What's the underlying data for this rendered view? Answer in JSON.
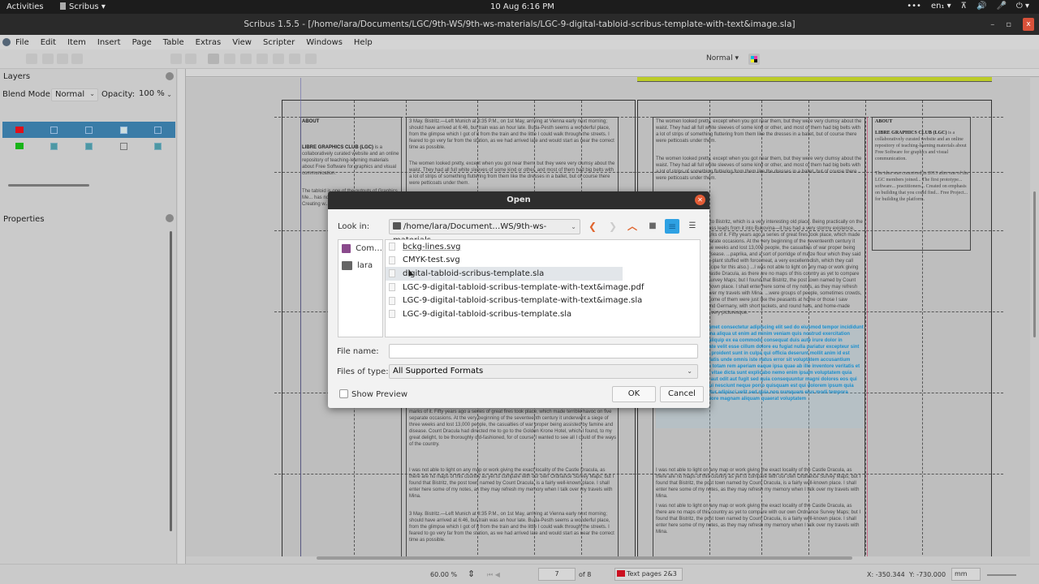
{
  "system_bar": {
    "activities": "Activities",
    "app_name": "Scribus",
    "app_menu_arrow": "▾",
    "clock": "10 Aug  6:16 PM",
    "tray": {
      "more": "•••",
      "language": "en₁ ▾",
      "network_icon": "⊼",
      "volume_icon": "🔊",
      "mic_icon": "🎤",
      "power_icon": "⏻ ▾"
    }
  },
  "window": {
    "title": "Scribus 1.5.5 - [/home/lara/Documents/LGC/9th-WS/9th-ws-materials/LGC-9-digital-tabloid-scribus-template-with-text&image.sla]",
    "minimize": "–",
    "maximize": "▫",
    "close": "x"
  },
  "menubar": [
    "File",
    "Edit",
    "Item",
    "Insert",
    "Page",
    "Table",
    "Extras",
    "View",
    "Scripter",
    "Windows",
    "Help"
  ],
  "toolbar": {
    "image_mode": "Normal",
    "image_mode_arrow": "▾"
  },
  "layers_panel": {
    "title": "Layers",
    "blend_mode_label": "Blend Mode:",
    "blend_mode_value": "Normal",
    "opacity_label": "Opacity:",
    "opacity_value": "100 %",
    "layers": [
      {
        "color": "#e0101a",
        "selected": true,
        "visible": false,
        "printable": false,
        "locked": true,
        "flow": false
      },
      {
        "color": "#18b418",
        "selected": false,
        "visible": true,
        "printable": true,
        "locked": false,
        "flow": true
      }
    ]
  },
  "properties_panel": {
    "title": "Properties"
  },
  "progress": {
    "fraction": 1.0,
    "color": "#bccc28"
  },
  "document": {
    "page_left": {
      "about_heading": "ABOUT",
      "about_body_bold": "LIBRE GRAPHICS CLUB (LGC)",
      "about_body": " is a collaboratively curated website and an online repository of teaching-learning materials about Free Software for graphics and visual communication.",
      "col2_text1": "3 May. Bistritz.—Left Munich at 8:35 P.M., on 1st May, arriving at Vienna early next morning; should have arrived at 6:46, but train was an hour late. Buda-Pesth seems a wonderful place, from the glimpse which I got of it from the train and the little I could walk through the streets. I feared to go very far from the station, as we had arrived late and would start as near the correct time as possible.",
      "col2_text2": "The women looked pretty, except when you got near them, but they were very clumsy about the waist. They had all full white sleeves of some kind or other, and most of them had big belts with a lot of strips of something fluttering from them like the dresses in a ballet, but of course there were petticoats under them.",
      "col1_text3": "The tabloid is one of the outputs of Graphics Me... has not a... software. T... designers... Creating w... this source...",
      "col2_text3": "marks of it. Fifty years ago a series of great fires took place, which made terrible havoc on five separate occasions. At the very beginning of the seventeenth century it underwent a siege of three weeks and lost 13,000 people, the casualties of war proper being assisted by famine and disease. Count Dracula had directed me to go to the Golden Krone Hotel, which I found, to my great delight, to be thoroughly old-fashioned, for of course I wanted to see all I could of the ways of the country.",
      "col2_text4": "I was not able to light on any map or work giving the exact locality of the Castle Dracula, as there are no maps of this country as yet to compare with our own Ordnance Survey Maps; but I found that Bistritz, the post town named by Count Dracula, is a fairly well-known place. I shall enter here some of my notes, as they may refresh my memory when I talk over my travels with Mina.",
      "col2_text5": "3 May. Bistritz.—Left Munich at 8:35 P.M., on 1st May, arriving at Vienna early next morning; should have arrived at 6:46, but train was an hour late. Buda-Pesth seems a wonderful place, from the glimpse which I got of it from the train and the little I could walk through the streets. I feared to go very far from the station, as we had arrived late and would start as near the correct time as possible."
    },
    "page_right": {
      "col1_text1": "The women looked pretty, except when you got near them, but they were very clumsy about the waist. They had all full white sleeves of some kind or other, and most of them had big belts with a lot of strips of something fluttering from them like the dresses in a ballet, but of course there were petticoats under them.",
      "col1_text2": "The women looked pretty, except when you got near them, but they were very clumsy about the waist. They had all full white sleeves of some kind or other, and most of them had big belts with a lot of strips of something fluttering from them like the dresses in a ballet, but of course there were petticoats under them.",
      "col1_text3": "...of twilight when we got to Bistritz, which is a very interesting old place. Being practically on the frontier—for the Borgo Pass leads from it into Bukovina—it has had a very stormy existence, and it certainly shows marks of it. Fifty years ago a series of great fires took place, which made terrible havoc on five separate occasions. At the very beginning of the seventeenth century it underwent a siege of three weeks and lost 13,000 people, the casualties of war proper being assisted by famine and disease. ...paprika, and a sort of porridge of maize flour which they said was \"mamaliga\", and egg-plant stuffed with forcemeat, a very excellent dish, which they call \"impletata\". (Mem., get recipe for this also.) ...I was not able to light on any map or work giving the exact locality of the Castle Dracula, as there are no maps of this country as yet to compare with our own Ordnance Survey Maps; but I found that Bistritz, the post town named by Count Dracula, is a fairly well-known place. I shall enter here some of my notes, as they may refresh my memory when I talk over my travels with Mina. ...were groups of people, sometimes crowds, and in all sorts of attire. Some of them were just like the peasants at home or those I saw coming through France and Germany, with short jackets, and round hats, and home-made trousers; but others were very picturesque.",
      "col1_text_overflow": "Lorem ipsum dolor sit amet consectetur adipiscing elit sed do eiusmod tempor incididunt ut labore et dolore magna aliqua ut enim ad minim veniam quis nostrud exercitation ullamco laboris nisi ut aliquip ex ea commodo consequat duis aute irure dolor in reprehenderit in voluptate velit esse cillum dolore eu fugiat nulla pariatur excepteur sint occaecat cupidatat non proident sunt in culpa qui officia deserunt mollit anim id est laborum sed ut perspiciatis unde omnis iste natus error sit voluptatem accusantium doloremque laudantium totam rem aperiam eaque ipsa quae ab illo inventore veritatis et quasi architecto beatae vitae dicta sunt explicabo nemo enim ipsam voluptatem quia voluptas sit aspernatur aut odit aut fugit sed quia consequuntur magni dolores eos qui ratione voluptatem sequi nesciunt neque porro quisquam est qui dolorem ipsum quia dolor sit amet consectetur adipisci velit sed quia non numquam eius modi tempora incidunt ut labore et dolore magnam aliquam quaerat voluptatem",
      "col1_text4": "I was not able to light on any map or work giving the exact locality of the Castle Dracula, as there are no maps of this country as yet to compare with our own Ordnance Survey Maps; but I found that Bistritz, the post town named by Count Dracula, is a fairly well-known place. I shall enter here some of my notes, as they may refresh my memory when I talk over my travels with Mina.",
      "col1_text5": "I was not able to light on any map or work giving the exact locality of the Castle Dracula, as there are no maps of this country as yet to compare with our own Ordnance Survey Maps; but I found that Bistritz, the post town named by Count Dracula, is a fairly well-known place. I shall enter here some of my notes, as they may refresh my memory when I talk over my travels with Mina.",
      "about_heading": "ABOUT",
      "about_body_bold": "LIBRE GRAPHICS CLUB (LGC)",
      "about_body": " is a collaboratively curated website and an online repository of teaching-learning materials about Free Software for graphics and visual communication.",
      "about_body2": "The idea was conceived in 2013 after one of the LGC members joined... The first prototype... software... practitioners... Created on emphasis on building that you could find... Free Project... for building the platform."
    }
  },
  "open_dialog": {
    "title": "Open",
    "look_in_label": "Look in:",
    "look_in_value": "/home/lara/Document…WS/9th-ws-materials",
    "look_in_arrow": "⌄",
    "nav": {
      "back": "❮",
      "forward": "❯",
      "up": "︿",
      "new_folder": "■",
      "list_view": "≡",
      "detail_view": "☰"
    },
    "places": [
      {
        "label": "Com…",
        "icon": "computer-icon"
      },
      {
        "label": "lara",
        "icon": "folder-icon"
      }
    ],
    "files": [
      {
        "name": "bckg-lines.svg",
        "selected": false
      },
      {
        "name": "CMYK-test.svg",
        "selected": false
      },
      {
        "name": "digital-tabloid-scribus-template.sla",
        "selected": true
      },
      {
        "name": "LGC-9-digital-tabloid-scribus-template-with-text&image.pdf",
        "selected": false
      },
      {
        "name": "LGC-9-digital-tabloid-scribus-template-with-text&image.sla",
        "selected": false
      },
      {
        "name": "LGC-9-digital-tabloid-scribus-template.sla",
        "selected": false
      }
    ],
    "file_name_label": "File name:",
    "file_name_value": "",
    "files_of_type_label": "Files of type:",
    "files_of_type_value": "All Supported Formats",
    "files_of_type_arrow": "⌄",
    "show_preview_label": "Show Preview",
    "show_preview_checked": false,
    "ok_label": "OK",
    "cancel_label": "Cancel"
  },
  "statusbar": {
    "zoom": "60.00 %",
    "zoom_spinner": "⇕",
    "page_current": "7",
    "page_of": "of 8",
    "layer_name": "Text pages 2&3",
    "layer_color": "#cc1020",
    "x_coord": "X: -350.344",
    "y_coord": "Y: -730.000",
    "unit": "mm"
  }
}
